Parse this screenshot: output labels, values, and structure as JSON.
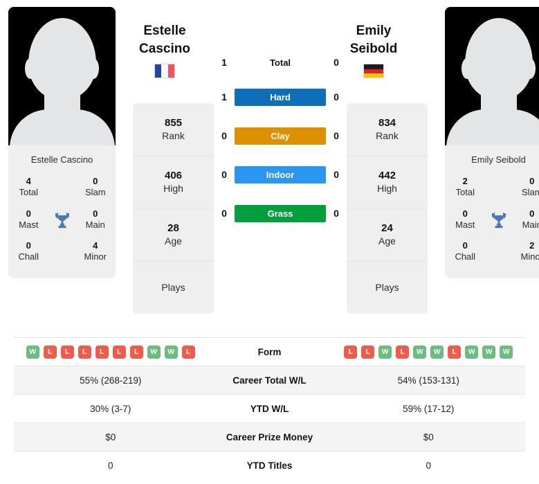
{
  "players": {
    "left": {
      "first_name": "Estelle",
      "last_name": "Cascino",
      "full_name": "Estelle Cascino",
      "country": "France",
      "flag_icon": "flag-france",
      "flag_orientation": "vertical",
      "flag_colors": [
        "#2347a0",
        "#f7f7f7",
        "#f0515e"
      ],
      "avatar_icon": "player-silhouette-avatar",
      "titles": {
        "total": "4",
        "total_label": "Total",
        "slam": "0",
        "slam_label": "Slam",
        "mast": "0",
        "mast_label": "Mast",
        "main": "0",
        "main_label": "Main",
        "chall": "0",
        "chall_label": "Chall",
        "minor": "4",
        "minor_label": "Minor"
      },
      "meta": [
        {
          "value": "855",
          "label": "Rank"
        },
        {
          "value": "406",
          "label": "High"
        },
        {
          "value": "28",
          "label": "Age"
        },
        {
          "value": "",
          "label": "Plays"
        }
      ],
      "form": [
        "W",
        "L",
        "L",
        "L",
        "L",
        "L",
        "L",
        "W",
        "W",
        "L"
      ],
      "career_total_wl": "55% (268-219)",
      "ytd_wl": "30% (3-7)",
      "career_prize_money": "$0",
      "ytd_titles": "0"
    },
    "right": {
      "first_name": "Emily",
      "last_name": "Seibold",
      "full_name": "Emily Seibold",
      "country": "Germany",
      "flag_icon": "flag-germany",
      "flag_orientation": "horizontal",
      "flag_colors": [
        "#1b1b1b",
        "#d8232a",
        "#f8c300"
      ],
      "avatar_icon": "player-silhouette-avatar",
      "titles": {
        "total": "2",
        "total_label": "Total",
        "slam": "0",
        "slam_label": "Slam",
        "mast": "0",
        "mast_label": "Mast",
        "main": "0",
        "main_label": "Main",
        "chall": "0",
        "chall_label": "Chall",
        "minor": "2",
        "minor_label": "Minor"
      },
      "meta": [
        {
          "value": "834",
          "label": "Rank"
        },
        {
          "value": "442",
          "label": "High"
        },
        {
          "value": "24",
          "label": "Age"
        },
        {
          "value": "",
          "label": "Plays"
        }
      ],
      "form": [
        "L",
        "L",
        "W",
        "L",
        "W",
        "W",
        "L",
        "W",
        "W",
        "W"
      ],
      "career_total_wl": "54% (153-131)",
      "ytd_wl": "59% (17-12)",
      "career_prize_money": "$0",
      "ytd_titles": "0"
    }
  },
  "head_to_head": {
    "total": {
      "label": "Total",
      "left": "1",
      "right": "0"
    },
    "surfaces": [
      {
        "label": "Hard",
        "left": "1",
        "right": "0",
        "color": "#0e6eb8"
      },
      {
        "label": "Clay",
        "left": "0",
        "right": "0",
        "color": "#dd9100"
      },
      {
        "label": "Indoor",
        "left": "0",
        "right": "0",
        "color": "#2b96f1"
      },
      {
        "label": "Grass",
        "left": "0",
        "right": "0",
        "color": "#049e3f"
      }
    ]
  },
  "comparison_table": {
    "rows": [
      {
        "label": "Form",
        "type": "form"
      },
      {
        "label": "Career Total W/L",
        "type": "text",
        "left": "55% (268-219)",
        "right": "54% (153-131)"
      },
      {
        "label": "YTD W/L",
        "type": "text",
        "left": "30% (3-7)",
        "right": "59% (17-12)"
      },
      {
        "label": "Career Prize Money",
        "type": "text",
        "left": "$0",
        "right": "$0"
      },
      {
        "label": "YTD Titles",
        "type": "text",
        "left": "0",
        "right": "0"
      }
    ]
  },
  "colors": {
    "badge_win": "#6abd7e",
    "badge_loss": "#f15b4a",
    "card_surface": "#efefef",
    "row_alt": "#f4f4f4",
    "trophy": "#4a77b4"
  }
}
